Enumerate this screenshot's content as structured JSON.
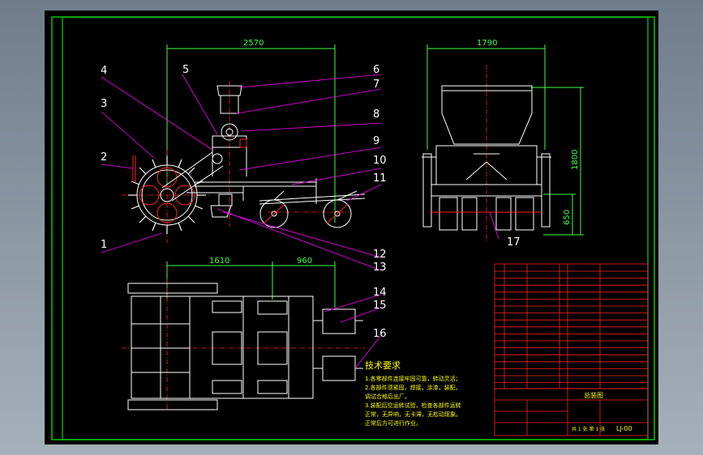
{
  "dimensions": {
    "side_length": "2570",
    "end_width": "1790",
    "end_height": "1800",
    "end_clearance": "650",
    "plan_front": "1610",
    "plan_rear": "960"
  },
  "callouts": [
    "1",
    "2",
    "3",
    "4",
    "5",
    "6",
    "7",
    "8",
    "9",
    "10",
    "11",
    "12",
    "13",
    "14",
    "15",
    "16",
    "17"
  ],
  "notes": {
    "heading": "技术要求",
    "lines": [
      "1.各零部件连接牢固可靠，转动灵活；",
      "2.各部件须紧固，焊接，涂漆，装配，",
      "  调试合格后出厂。",
      "3.装配后空运转试验，检查各部件运转",
      "  正常，无异响，无卡滞，无松动现象。",
      "  正常后方可进行作业。"
    ]
  },
  "title_block": {
    "drawing_title": "总装图",
    "drawing_no": "LJ-00",
    "scale_label": "共 1 张  第 1 张"
  },
  "colors": {
    "background": "#000000",
    "frame": "#00c800",
    "drawing": "#ffffff",
    "centerline": "#ff2020",
    "dimension": "#00e0e0",
    "leader": "#ff00ff",
    "callout": "#ffffff",
    "table": "#ff2020",
    "text": "#ffff00",
    "dim_green": "#40ff40"
  }
}
